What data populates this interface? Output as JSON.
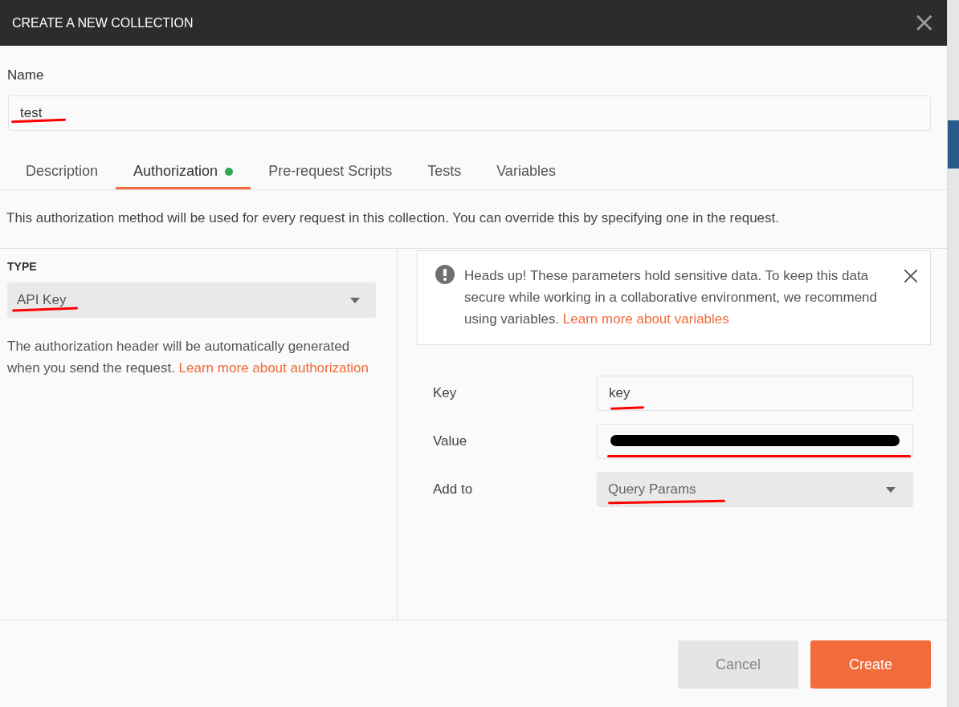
{
  "dialog": {
    "title": "CREATE A NEW COLLECTION",
    "close": "×"
  },
  "name_field": {
    "label": "Name",
    "value": "test",
    "marked": true
  },
  "tabs": [
    {
      "label": "Description",
      "selected": false,
      "dot": false
    },
    {
      "label": "Authorization",
      "selected": true,
      "dot": true
    },
    {
      "label": "Pre-request Scripts",
      "selected": false,
      "dot": false
    },
    {
      "label": "Tests",
      "selected": false,
      "dot": false
    },
    {
      "label": "Variables",
      "selected": false,
      "dot": false
    }
  ],
  "intro": "This authorization method will be used for every request in this collection. You can override this by specifying one in the request.",
  "type_panel": {
    "heading": "TYPE",
    "select": {
      "value": "API Key",
      "marked": true
    },
    "help": "The authorization header will be automatically generated when you send the request.",
    "link": "Learn more about authorization"
  },
  "notice": {
    "text": "Heads up! These parameters hold sensitive data. To keep this data secure while working in a collaborative environment, we recommend using variables.",
    "link": "Learn more about variables"
  },
  "fields": [
    {
      "label": "Key",
      "kind": "input",
      "value": "key",
      "marked": true,
      "redacted": false
    },
    {
      "label": "Value",
      "kind": "input",
      "marked": true,
      "redacted": true
    },
    {
      "label": "Add to",
      "kind": "select",
      "value": "Query Params",
      "marked": true,
      "redacted": false
    }
  ],
  "buttons": [
    {
      "label": "Cancel",
      "kind": "secondary"
    },
    {
      "label": "Create",
      "kind": "primary"
    }
  ]
}
